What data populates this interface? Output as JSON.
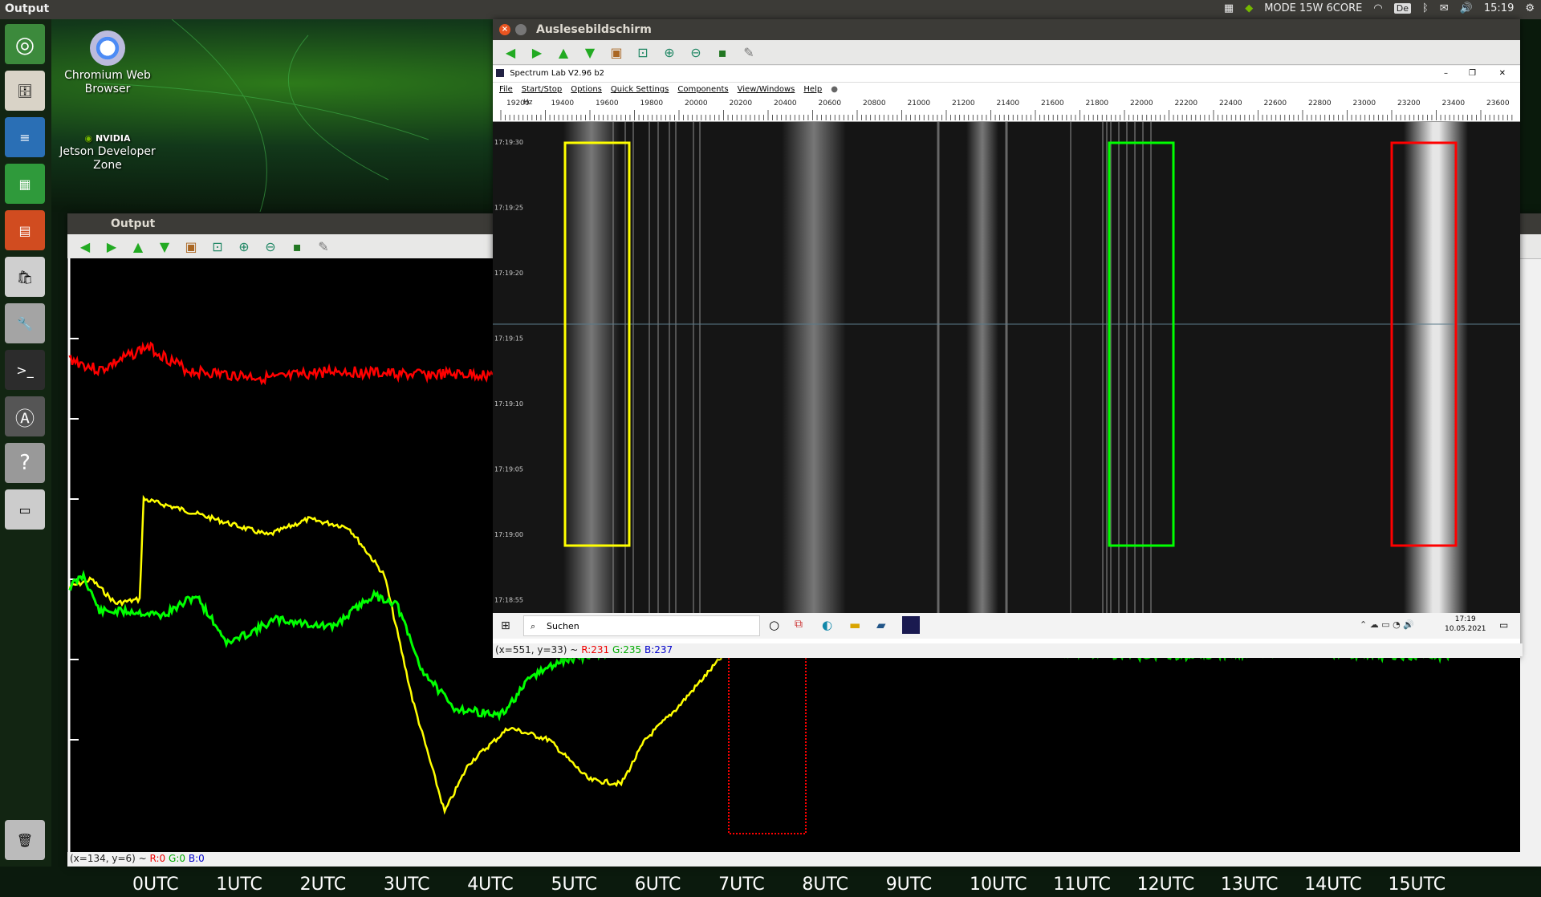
{
  "top_panel": {
    "app_title": "Output",
    "mode_label": "MODE 15W 6CORE",
    "keyboard": "De",
    "time": "15:19"
  },
  "desktop_icons": [
    {
      "label": "Chromium Web Browser",
      "icon": "chromium-icon"
    },
    {
      "label": "Jetson Developer Zone",
      "icon": "nvidia-icon",
      "brand": "NVIDIA"
    }
  ],
  "launcher": [
    "ubuntu-icon",
    "files-icon",
    "writer-icon",
    "calc-icon",
    "impress-icon",
    "software-icon",
    "settings-icon",
    "terminal-icon",
    "updater-icon",
    "help-icon",
    "drive-icon",
    "trash-icon"
  ],
  "output_window": {
    "title": "Output",
    "status": {
      "coords": "(x=134, y=6) ~",
      "r": "R:0",
      "g": "G:0",
      "b": "B:0"
    },
    "x_labels": [
      "0UTC",
      "1UTC",
      "2UTC",
      "3UTC",
      "4UTC",
      "5UTC",
      "6UTC",
      "7UTC",
      "8UTC",
      "9UTC",
      "10UTC",
      "11UTC",
      "12UTC",
      "13UTC",
      "14UTC",
      "15UTC"
    ]
  },
  "reader_window": {
    "title": "Auslesebildschirm",
    "status": {
      "coords": "(x=551, y=33) ~",
      "r": "R:231",
      "g": "G:235",
      "b": "B:237"
    }
  },
  "spectrum_lab": {
    "title": "Spectrum Lab V2.96 b2",
    "menu": [
      "File",
      "Start/Stop",
      "Options",
      "Quick Settings",
      "Components",
      "View/Windows",
      "Help"
    ],
    "freq_unit": "Hz",
    "freq_labels": [
      "19200",
      "19400",
      "19600",
      "19800",
      "20000",
      "20200",
      "20400",
      "20600",
      "20800",
      "21000",
      "21200",
      "21400",
      "21600",
      "21800",
      "22000",
      "22200",
      "22400",
      "22600",
      "22800",
      "23000",
      "23200",
      "23400",
      "23600"
    ],
    "timestamps": [
      "17:19:30",
      "17:19:25",
      "17:19:20",
      "17:19:15",
      "17:19:10",
      "17:19:05",
      "17:19:00",
      "17:18:55"
    ],
    "taskbar": {
      "search": "Suchen",
      "time": "17:19",
      "date": "10.05.2021"
    }
  },
  "colors": {
    "red": "#ff0000",
    "yellow": "#ffff00",
    "green": "#00ff00"
  }
}
